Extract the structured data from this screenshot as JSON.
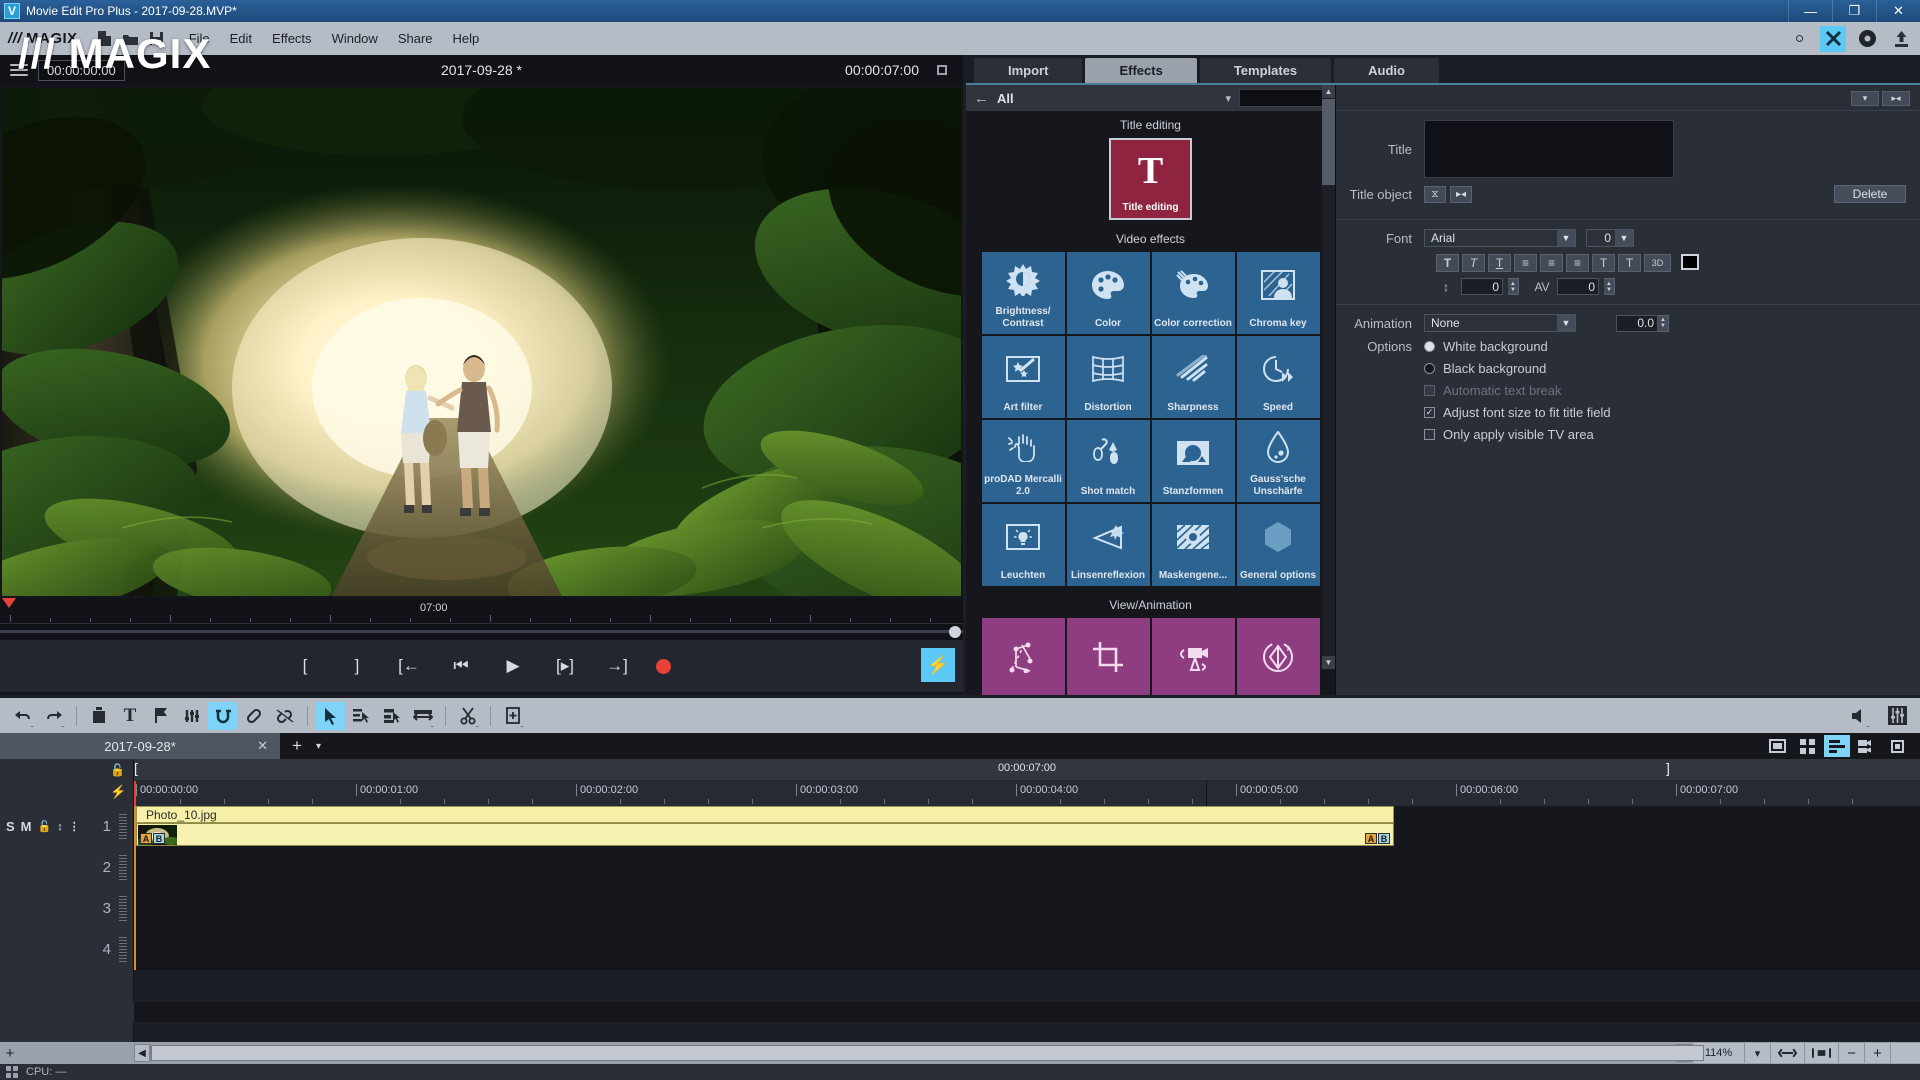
{
  "window": {
    "title": "Movie Edit Pro Plus - 2017-09-28.MVP*",
    "minimize_label": "—",
    "restore_label": "❐",
    "close_label": "✕"
  },
  "menubar": {
    "brand": "MAGIX",
    "brand_slashes": "///",
    "icons": [
      "new-document-icon",
      "open-folder-icon",
      "save-disk-icon"
    ],
    "items": [
      "File",
      "Edit",
      "Effects",
      "Window",
      "Share",
      "Help"
    ],
    "right_icons": [
      "small-circle-icon",
      "scissors-blue-icon",
      "disc-icon",
      "upload-icon"
    ]
  },
  "watermark": "/// MAGIX",
  "preview": {
    "timecode_current": "00:00:00:00",
    "project_title": "2017-09-28 *",
    "timecode_total": "00:00:07:00",
    "ruler_label": "07:00",
    "transport_buttons": [
      {
        "name": "set-in-point",
        "glyph": "["
      },
      {
        "name": "set-out-point",
        "glyph": "]"
      },
      {
        "name": "jump-to-start",
        "glyph": "[←"
      },
      {
        "name": "previous-frame",
        "glyph": "⏮"
      },
      {
        "name": "play",
        "glyph": "▶"
      },
      {
        "name": "next-frame",
        "glyph": "[▸]"
      },
      {
        "name": "jump-to-end",
        "glyph": "→]"
      },
      {
        "name": "record",
        "glyph": ""
      }
    ],
    "flash_button": "⚡"
  },
  "media_panel": {
    "tabs": [
      {
        "label": "Import",
        "active": false
      },
      {
        "label": "Effects",
        "active": true
      },
      {
        "label": "Templates",
        "active": false
      },
      {
        "label": "Audio",
        "active": false
      }
    ],
    "filter": {
      "back_icon": "back-arrow-icon",
      "category": "All",
      "chevron": "▾",
      "search_value": "",
      "search_placeholder": ""
    },
    "sections": [
      {
        "title": "Title editing",
        "tiles": [
          {
            "label": "Title editing",
            "icon": "big-T-icon",
            "color": "#8e2440",
            "selected": true
          }
        ]
      },
      {
        "title": "Video effects",
        "tiles": [
          {
            "label": "Brightness/\nContrast",
            "icon": "sun-contrast-icon"
          },
          {
            "label": "Color",
            "icon": "palette-icon"
          },
          {
            "label": "Color correction",
            "icon": "palette-brush-icon"
          },
          {
            "label": "Chroma key",
            "icon": "person-hatched-icon"
          },
          {
            "label": "Art filter",
            "icon": "art-stars-icon"
          },
          {
            "label": "Distortion",
            "icon": "grid-warp-icon"
          },
          {
            "label": "Sharpness",
            "icon": "sharpen-lines-icon"
          },
          {
            "label": "Speed",
            "icon": "clock-forward-icon"
          },
          {
            "label": "proDAD Mercalli 2.0",
            "icon": "shaking-hand-icon"
          },
          {
            "label": "Shot match",
            "icon": "eyedropper-icon"
          },
          {
            "label": "Stanzformen",
            "icon": "mask-shapes-icon"
          },
          {
            "label": "Gauss'sche Unschärfe",
            "icon": "blur-drop-icon"
          },
          {
            "label": "Leuchten",
            "icon": "lightbulb-glow-icon"
          },
          {
            "label": "Linsenreflexion",
            "icon": "lens-flare-icon"
          },
          {
            "label": "Maskengene...",
            "icon": "mask-generator-icon"
          },
          {
            "label": "General options",
            "icon": "hexagon-icon"
          }
        ]
      },
      {
        "title": "View/Animation",
        "tiles": [
          {
            "label": "",
            "icon": "motion-path-icon"
          },
          {
            "label": "",
            "icon": "crop-icon"
          },
          {
            "label": "",
            "icon": "camera-pan-icon"
          },
          {
            "label": "",
            "icon": "rotate-3d-icon"
          }
        ]
      }
    ],
    "scrollbar": {
      "up": "▲",
      "down": "▼"
    }
  },
  "properties": {
    "top_buttons": [
      {
        "name": "preset-dropdown-button",
        "glyph": "▾"
      },
      {
        "name": "collapse-panel-button",
        "glyph": "▸◂"
      }
    ],
    "title_label": "Title",
    "title_value": "",
    "title_object_label": "Title object",
    "title_object_buttons": [
      {
        "name": "center-vertical-button",
        "glyph": "⧖"
      },
      {
        "name": "center-horizontal-button",
        "glyph": "▸◂"
      }
    ],
    "delete_label": "Delete",
    "font_label": "Font",
    "font_value": "Arial",
    "font_size_value": "0",
    "format_buttons": [
      {
        "name": "bold-button",
        "glyph": "T"
      },
      {
        "name": "italic-button",
        "glyph": "T"
      },
      {
        "name": "underline-button",
        "glyph": "T"
      },
      {
        "name": "align-left-button",
        "glyph": "≡"
      },
      {
        "name": "align-center-button",
        "glyph": "≡"
      },
      {
        "name": "align-right-button",
        "glyph": "≡"
      },
      {
        "name": "outline-button",
        "glyph": "T"
      },
      {
        "name": "shadow-button",
        "glyph": "T"
      },
      {
        "name": "three-d-button",
        "glyph": "3D"
      }
    ],
    "color_swatch": "#000000",
    "line_spacing_icon": "line-spacing-icon",
    "line_spacing_value": "0",
    "letter_spacing_icon": "letter-spacing-icon",
    "letter_spacing_value": "0",
    "animation_label": "Animation",
    "animation_value": "None",
    "animation_speed_value": "0.0",
    "options_label": "Options",
    "options": [
      {
        "label": "White background",
        "type": "radio",
        "checked": true,
        "disabled": false
      },
      {
        "label": "Black background",
        "type": "radio",
        "checked": false,
        "disabled": false
      },
      {
        "label": "Automatic text break",
        "type": "checkbox",
        "checked": false,
        "disabled": true
      },
      {
        "label": "Adjust font size to fit title field",
        "type": "checkbox",
        "checked": true,
        "disabled": false
      },
      {
        "label": "Only apply visible TV area",
        "type": "checkbox",
        "checked": false,
        "disabled": false
      }
    ]
  },
  "timeline_toolbar": {
    "buttons": [
      {
        "name": "undo-button",
        "glyph": "↶",
        "active": false
      },
      {
        "name": "redo-button",
        "glyph": "↷",
        "active": false
      },
      {
        "name": "delete-button",
        "glyph": "Ὕ1",
        "active": false
      },
      {
        "name": "title-button",
        "glyph": "T",
        "active": false
      },
      {
        "name": "marker-button",
        "glyph": "⚑",
        "active": false
      },
      {
        "name": "audio-mix-button",
        "glyph": "⫼",
        "active": false
      },
      {
        "name": "loop-button",
        "glyph": "↻",
        "active": true
      },
      {
        "name": "link-button",
        "glyph": "ὑ7",
        "active": false
      },
      {
        "name": "unlink-button",
        "glyph": "⛓",
        "active": false
      },
      {
        "name": "selection-tool-button",
        "glyph": "➤",
        "active": true
      },
      {
        "name": "single-object-tool-button",
        "glyph": "⮞",
        "active": false
      },
      {
        "name": "multi-object-tool-button",
        "glyph": "⮞",
        "active": false
      },
      {
        "name": "stretch-tool-button",
        "glyph": "↔",
        "active": false
      },
      {
        "name": "cut-tool-button",
        "glyph": "✂",
        "active": false
      },
      {
        "name": "insert-tool-button",
        "glyph": "⊞",
        "active": false
      }
    ],
    "right_buttons": [
      {
        "name": "volume-button",
        "glyph": "ὐa"
      },
      {
        "name": "mixer-button",
        "glyph": "≣"
      }
    ]
  },
  "tabstrip": {
    "project_tab": "2017-09-28*",
    "close_glyph": "✕",
    "add_glyph": "+",
    "chevron_glyph": "▾",
    "view_buttons": [
      {
        "name": "storyboard-view-button",
        "glyph": "▭",
        "active": false
      },
      {
        "name": "scene-overview-button",
        "glyph": "⌸",
        "active": false
      },
      {
        "name": "timeline-view-button",
        "glyph": "≡",
        "active": true
      },
      {
        "name": "multicam-view-button",
        "glyph": "὏9",
        "active": false
      },
      {
        "name": "maximize-view-button",
        "glyph": "▫",
        "active": false
      }
    ]
  },
  "timeline": {
    "range_label": "00:00:07:00",
    "bracket_open": "[",
    "bracket_close": "]",
    "ruler_labels": [
      "00:00:00:00",
      "00:00:01:00",
      "00:00:02:00",
      "00:00:03:00",
      "00:00:04:00",
      "00:00:05:00",
      "00:00:06:00",
      "00:00:07:00"
    ],
    "track_controls": [
      "S",
      "M",
      "ὑ3",
      "↕",
      "⫶"
    ],
    "tracks": [
      {
        "number": "1",
        "clip": {
          "name": "Photo_10.jpg",
          "fade_left": [
            "A",
            "B"
          ],
          "fade_right": [
            "A",
            "B"
          ]
        }
      },
      {
        "number": "2",
        "clip": null
      },
      {
        "number": "3",
        "clip": null
      },
      {
        "number": "4",
        "clip": null
      }
    ],
    "add_track_glyph": "+",
    "zoom_value": "114%",
    "zoom_chevron": "▾",
    "zoom_buttons": [
      {
        "name": "fit-width-button",
        "glyph": "⧼⧽"
      },
      {
        "name": "fit-selection-button",
        "glyph": "⬚"
      },
      {
        "name": "zoom-out-button",
        "glyph": "−"
      },
      {
        "name": "zoom-in-button",
        "glyph": "+"
      }
    ],
    "scroll_left_glyph": "◀",
    "scroll_right_glyph": "▶"
  },
  "statusbar": {
    "cpu_label": "CPU: —",
    "grid_icon": "grid-icon"
  },
  "colors": {
    "accent_blue": "#5cc8f5",
    "tile_blue": "#2d6391",
    "tile_purple": "#8d3d80",
    "title_red": "#8e2440",
    "clip_yellow": "#f8f2b0",
    "record_red": "#e8413a",
    "playhead_orange": "#e08a2a"
  }
}
